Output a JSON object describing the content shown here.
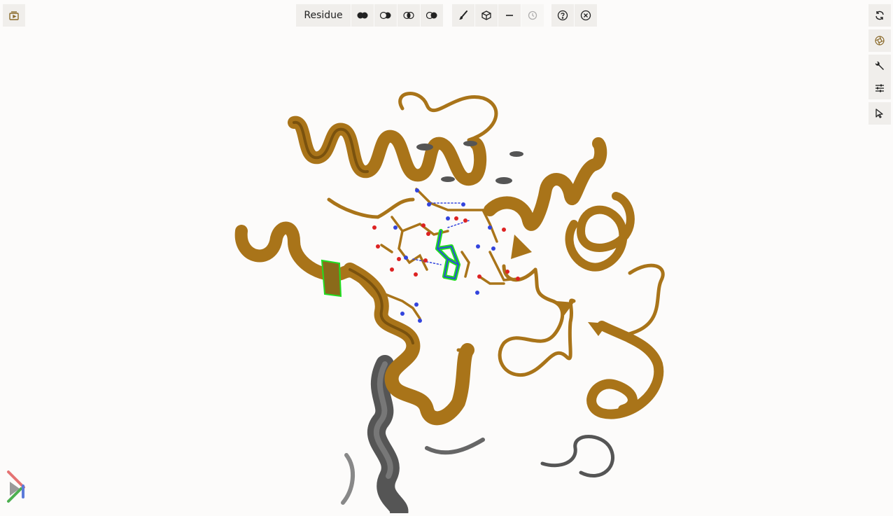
{
  "toolbar": {
    "selection_mode_label": "Residue"
  },
  "colors": {
    "cartoon": "#a97419",
    "cartoon_dark": "#7a520e",
    "chain_b": "#4d4d4d",
    "highlight": "#22dd22",
    "oxygen": "#dd2222",
    "nitrogen": "#3344dd",
    "button_bg": "#f0eeeb",
    "background": "#fcfbfa"
  },
  "icons": {
    "left": "expand-panel-icon",
    "selection": [
      "union-icon",
      "subtract-icon",
      "intersect-icon",
      "set-icon"
    ],
    "tools": [
      "brush-icon",
      "cube-icon",
      "minus-icon",
      "history-icon"
    ],
    "help": [
      "help-icon",
      "close-icon"
    ],
    "right": [
      "reset-camera-icon",
      "screenshot-icon",
      "wrench-icon",
      "sliders-icon",
      "pointer-icon"
    ]
  }
}
